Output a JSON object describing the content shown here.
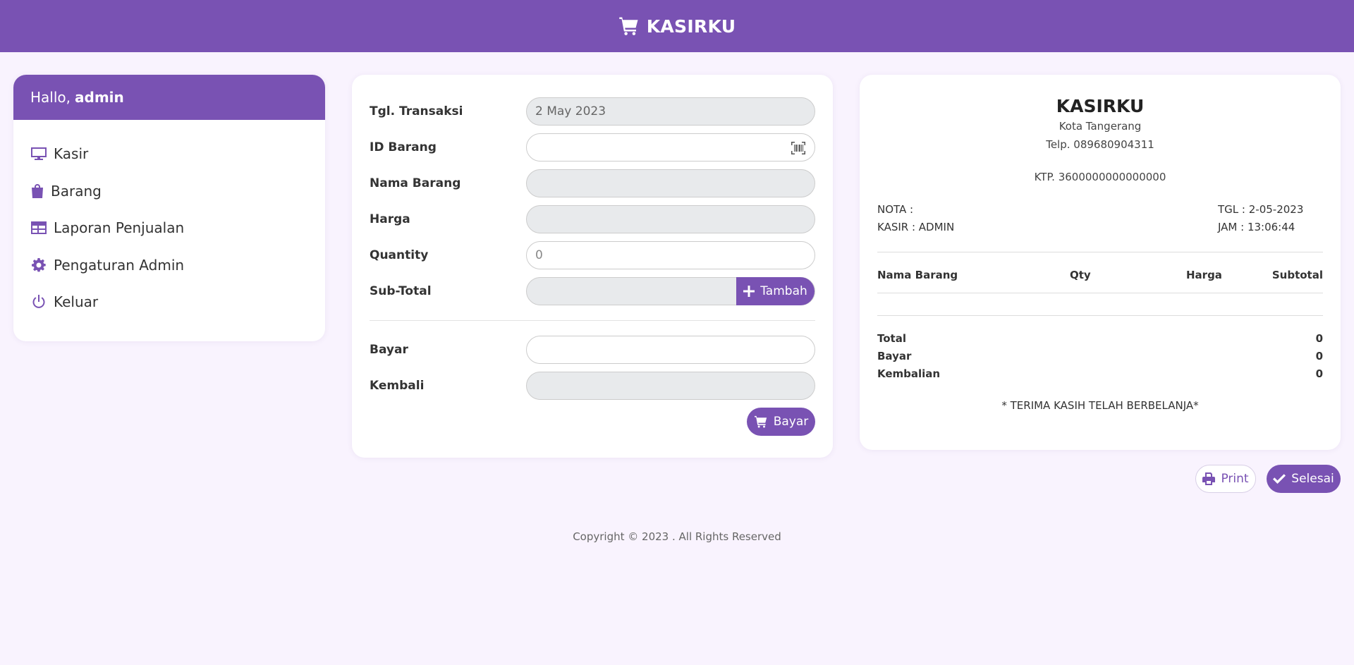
{
  "app": {
    "title": "KASIRKU",
    "accent": "#7952b3",
    "background": "#f9f3fe"
  },
  "sidebar": {
    "greeting": "Hallo,",
    "username": "admin",
    "items": [
      {
        "label": "Kasir",
        "icon": "monitor-icon"
      },
      {
        "label": "Barang",
        "icon": "shopping-bag-icon"
      },
      {
        "label": "Laporan Penjualan",
        "icon": "table-icon"
      },
      {
        "label": "Pengaturan Admin",
        "icon": "gear-icon"
      },
      {
        "label": "Keluar",
        "icon": "power-icon"
      }
    ]
  },
  "form": {
    "tgl_label": "Tgl. Transaksi",
    "tgl_value": "2 May 2023",
    "id_label": "ID Barang",
    "id_value": "",
    "nama_label": "Nama Barang",
    "nama_value": "",
    "harga_label": "Harga",
    "harga_value": "",
    "qty_label": "Quantity",
    "qty_placeholder": "0",
    "subtotal_label": "Sub-Total",
    "subtotal_value": "",
    "tambah_label": "Tambah",
    "bayar_label": "Bayar",
    "bayar_value": "",
    "kembali_label": "Kembali",
    "kembali_value": "",
    "bayar_button": "Bayar"
  },
  "receipt": {
    "store_name": "KASIRKU",
    "city": "Kota Tangerang",
    "phone": "Telp. 089680904311",
    "ktp": "KTP. 3600000000000000",
    "nota": "NOTA :",
    "kasir": "KASIR : ADMIN",
    "tgl": "TGL : 2-05-2023",
    "jam": "JAM : 13:06:44",
    "columns": [
      "Nama Barang",
      "Qty",
      "Harga",
      "Subtotal"
    ],
    "totals": [
      {
        "label": "Total",
        "value": "0"
      },
      {
        "label": "Bayar",
        "value": "0"
      },
      {
        "label": "Kembalian",
        "value": "0"
      }
    ],
    "thanks": "* TERIMA KASIH TELAH BERBELANJA*"
  },
  "actions": {
    "print": "Print",
    "selesai": "Selesai"
  },
  "footer": {
    "copyright": "Copyright © 2023 . All Rights Reserved"
  }
}
